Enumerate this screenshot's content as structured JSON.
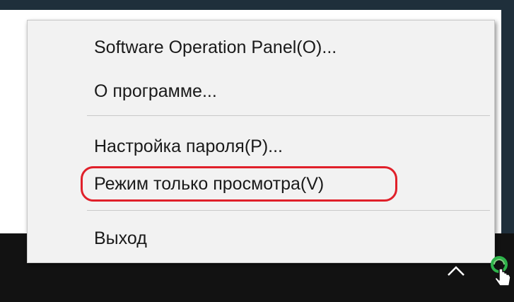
{
  "context_menu": {
    "items": [
      {
        "label": "Software Operation Panel(O)..."
      },
      {
        "label": "О программе..."
      },
      {
        "label": "Настройка пароля(P)..."
      },
      {
        "label": "Режим только просмотра(V)",
        "highlighted": true
      },
      {
        "label": "Выход"
      }
    ]
  },
  "highlight_color": "#e0202a",
  "taskbar": {
    "icons": [
      "chevron-up-icon",
      "scanner-app-icon",
      "hand-cursor-icon"
    ]
  }
}
